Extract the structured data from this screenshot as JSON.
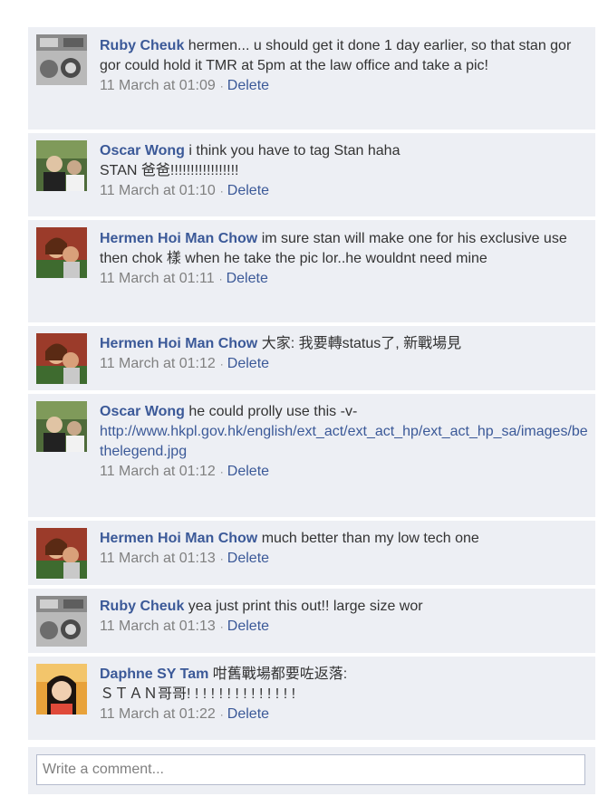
{
  "comments": [
    {
      "author": "Ruby Cheuk",
      "text": "hermen... u should get it done 1 day earlier, so that stan gor gor could hold it TMR at 5pm at the law office and take a pic!",
      "link": "",
      "time": "11 March at 01:09",
      "action": "Delete",
      "avatar": "ruby-avatar"
    },
    {
      "author": "Oscar Wong",
      "text": "i think you have to tag Stan haha\nSTAN 爸爸!!!!!!!!!!!!!!!!!",
      "link": "",
      "time": "11 March at 01:10",
      "action": "Delete",
      "avatar": "oscar-avatar"
    },
    {
      "author": "Hermen Hoi Man Chow",
      "text": "im sure stan will make one for his exclusive use then chok 樣 when he take the pic lor..he wouldnt need mine",
      "link": "",
      "time": "11 March at 01:11",
      "action": "Delete",
      "avatar": "hermen-avatar"
    },
    {
      "author": "Hermen Hoi Man Chow",
      "text": "大家: 我要轉status了, 新戰場見",
      "link": "",
      "time": "11 March at 01:12",
      "action": "Delete",
      "avatar": "hermen-avatar"
    },
    {
      "author": "Oscar Wong",
      "text": "he could prolly use this -v-\n",
      "link": "http://www.hkpl.gov.hk/english/ext_act/ext_act_hp/ext_act_hp_sa/images/bethelegend.jpg",
      "time": "11 March at 01:12",
      "action": "Delete",
      "avatar": "oscar-avatar"
    },
    {
      "author": "Hermen Hoi Man Chow",
      "text": "much better than my low tech one",
      "link": "",
      "time": "11 March at 01:13",
      "action": "Delete",
      "avatar": "hermen-avatar"
    },
    {
      "author": "Ruby Cheuk",
      "text": "yea just print this out!! large size wor",
      "link": "",
      "time": "11 March at 01:13",
      "action": "Delete",
      "avatar": "ruby-avatar"
    },
    {
      "author": "Daphne SY Tam",
      "text": "咁舊戰場都要咗返落:\nＳＴＡＮ哥哥! ! ! ! ! ! ! ! ! ! ! ! ! !",
      "link": "",
      "time": "11 March at 01:22",
      "action": "Delete",
      "avatar": "daphne-avatar"
    }
  ],
  "write_comment": {
    "placeholder": "Write a comment..."
  },
  "colors": {
    "author": "#3b5998",
    "background": "#edeff4",
    "meta": "#808080"
  }
}
